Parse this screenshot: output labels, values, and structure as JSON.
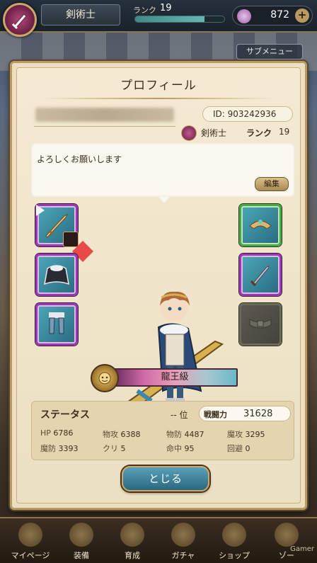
{
  "header": {
    "class_name": "剣術士",
    "rank_label": "ランク",
    "rank_value": "19",
    "rank_progress": 0.78,
    "gems": "872",
    "gem_add": "+",
    "submenu_label": "サブメニュー"
  },
  "profile": {
    "title": "プロフィール",
    "id_text": "ID: 903242936",
    "class_name": "剣術士",
    "rank_label": "ランク",
    "rank_value": "19",
    "comment": "よろしくお願いします",
    "edit_label": "編集",
    "tier_label": "龍王級"
  },
  "equipment": {
    "left": [
      "sword-icon",
      "cape-icon",
      "boots-icon"
    ],
    "right": [
      "armor-icon",
      "dagger-icon",
      "belt-icon"
    ]
  },
  "status": {
    "title": "ステータス",
    "rank_text": "-- 位",
    "power_label": "戦闘力",
    "power_value": "31628",
    "stats": [
      {
        "k": "HP",
        "v": "6786"
      },
      {
        "k": "物攻",
        "v": "6388"
      },
      {
        "k": "物防",
        "v": "4487"
      },
      {
        "k": "魔攻",
        "v": "3295"
      },
      {
        "k": "魔防",
        "v": "3393"
      },
      {
        "k": "クリ",
        "v": "5"
      },
      {
        "k": "命中",
        "v": "95"
      },
      {
        "k": "回避",
        "v": "0"
      }
    ]
  },
  "close_label": "とじる",
  "nav": [
    "マイページ",
    "装備",
    "育成",
    "ガチャ",
    "ショップ",
    "ゾー"
  ],
  "watermark": "Gamer",
  "colors": {
    "panel": "#ecdfc0",
    "frame": "#b89a62",
    "slot_purple": "#9a3ab0",
    "close_button": "#2a6880"
  }
}
